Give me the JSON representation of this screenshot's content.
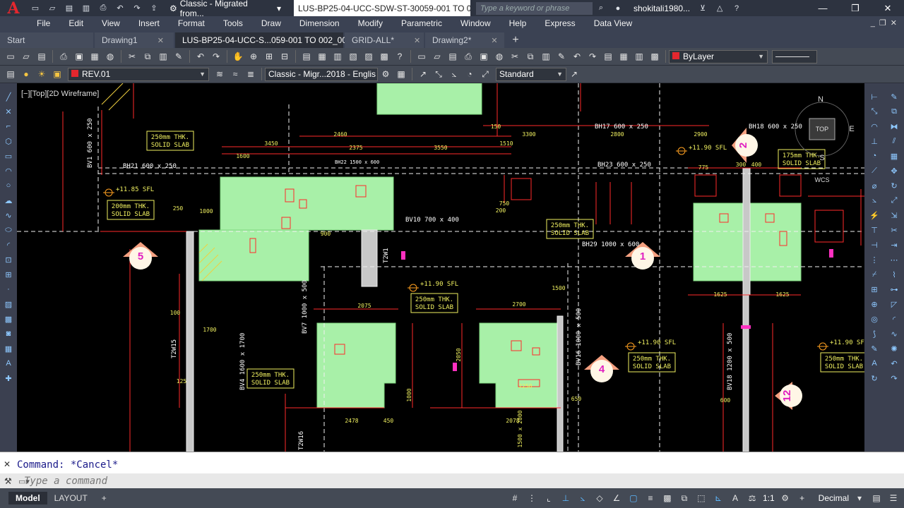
{
  "app": {
    "logo": "A",
    "workspace": "Classic - Migrated from...",
    "document_title": "LUS-BP25-04-UCC-SDW-ST-30059-001 TO 002_...",
    "search_placeholder": "Type a keyword or phrase",
    "user": "shokitali1980..."
  },
  "menus": [
    "File",
    "Edit",
    "View",
    "Insert",
    "Format",
    "Tools",
    "Draw",
    "Dimension",
    "Modify",
    "Parametric",
    "Window",
    "Help",
    "Express",
    "Data View"
  ],
  "tabs": [
    {
      "label": "Start",
      "active": false
    },
    {
      "label": "Drawing1",
      "active": false
    },
    {
      "label": "LUS-BP25-04-UCC-S...059-001 TO 002_00*",
      "active": true
    },
    {
      "label": "GRID-ALL*",
      "active": false
    },
    {
      "label": "Drawing2*",
      "active": false
    }
  ],
  "toolbar": {
    "layer": "REV.01",
    "text_style": "Classic - Migr...2018 - Englis",
    "dim_style": "Standard",
    "color": "ByLayer"
  },
  "viewport": {
    "label": "[−][Top][2D Wireframe]"
  },
  "drawing": {
    "slab_labels": [
      "250mm THK.",
      "SOLID SLAB",
      "200mm THK.",
      "175mm THK."
    ],
    "level_tag": "+11.90 SFL",
    "level_tag_alt": "+11.85 SFL",
    "beams": [
      "BH21 600 x 250",
      "BH22 1500 x 600",
      "BH17 600 x 250",
      "BH18 600 x 250",
      "BH23 600 x 250",
      "BV10 700 x 400",
      "BH29 1000 x 600",
      "BV1 600 x 250",
      "BV7 1000 x 500",
      "BV4 1600 x 1700",
      "BV16 1000 x 500",
      "BV18 1200 x 500",
      "T2W1",
      "T2W15",
      "T2W16"
    ],
    "grid_bubbles": [
      "5",
      "1",
      "4",
      "12",
      "2"
    ],
    "dims": [
      "3450",
      "1600",
      "2375",
      "3550",
      "1510",
      "2460",
      "3300",
      "2800",
      "2900",
      "1000",
      "900",
      "2075",
      "2700",
      "2250",
      "1700",
      "1625",
      "1625",
      "600",
      "775",
      "300",
      "400",
      "150",
      "250",
      "200",
      "750",
      "1500",
      "100",
      "125",
      "450",
      "650",
      "2050",
      "1000",
      "1500 x 2000",
      "2478",
      "2078"
    ],
    "compass": {
      "n": "N",
      "s": "S",
      "e": "E",
      "top": "TOP",
      "wcs": "WCS"
    }
  },
  "command": {
    "history": "Command: *Cancel*",
    "placeholder": "Type a command"
  },
  "status": {
    "model_tab": "Model",
    "layout_tab": "LAYOUT",
    "scale": "1:1",
    "units": "Decimal"
  },
  "colors": {
    "slab": "#a8f0a8",
    "dimension": "#ff2a2a",
    "text_yellow": "#f0f060",
    "grid": "#f5f5f5",
    "background": "#000000"
  }
}
